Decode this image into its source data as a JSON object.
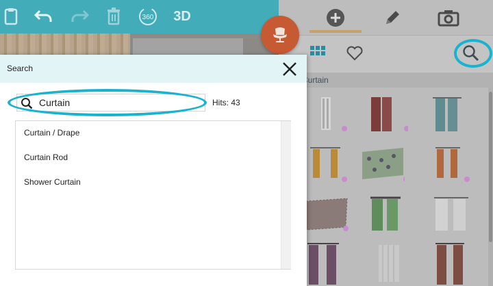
{
  "toolbar": {
    "items": [
      "clipboard-icon",
      "undo-icon",
      "redo-icon",
      "trash-icon",
      "360-view-icon",
      "3d-view-button"
    ],
    "label_360": "360",
    "label_3d": "3D"
  },
  "right_panel": {
    "tabs": [
      "add-icon",
      "edit-pencil-icon",
      "camera-icon"
    ],
    "subtabs": [
      "grid-view-icon",
      "favorites-heart-icon",
      "search-icon"
    ],
    "breadcrumb": "Curtain",
    "thumbnails": [
      "curtain-white-thumbnail",
      "curtain-maroon-thumbnail",
      "curtain-teal-thumbnail",
      "curtain-yellow-thumbnail",
      "curtain-patterned-thumbnail",
      "curtain-orange-thumbnail",
      "curtain-speckled-thumbnail",
      "curtain-green-thumbnail",
      "curtain-white-sheer-thumbnail",
      "curtain-purple-thumbnail",
      "curtain-grey-thumbnail",
      "curtain-brown-thumbnail"
    ]
  },
  "modal": {
    "title": "Search",
    "search": {
      "value": "Curtain",
      "placeholder": ""
    },
    "hits_label": "Hits: 43",
    "results": [
      "Curtain / Drape",
      "Curtain Rod",
      "Shower Curtain"
    ]
  },
  "colors": {
    "toolbar": "#43acb9",
    "fab": "#c65a33",
    "highlight": "#17b3cf",
    "active_tab_underline": "#c7a168",
    "modal_header": "#e2f4f6"
  }
}
